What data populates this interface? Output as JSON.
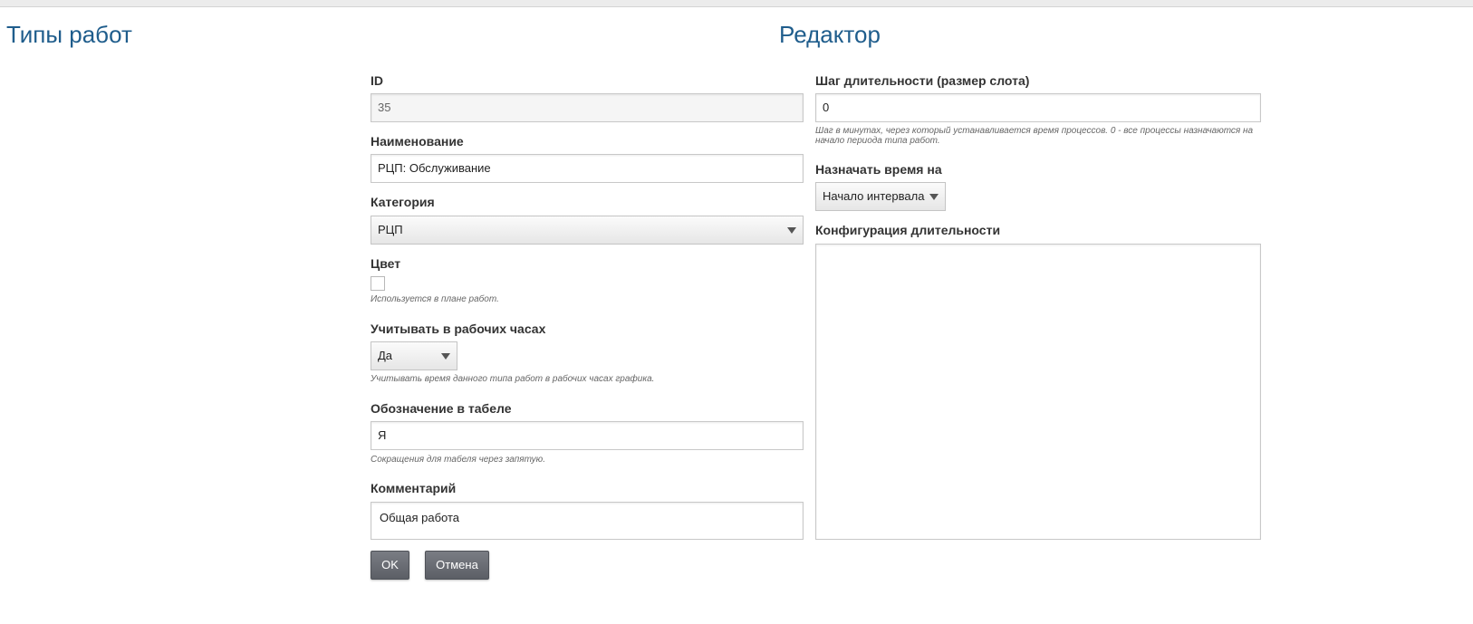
{
  "header": {
    "left_title": "Типы работ",
    "right_title": "Редактор"
  },
  "form": {
    "id": {
      "label": "ID",
      "value": "35"
    },
    "name": {
      "label": "Наименование",
      "value": "РЦП: Обслуживание"
    },
    "category": {
      "label": "Категория",
      "value": "РЦП"
    },
    "color": {
      "label": "Цвет",
      "hint": "Используется в плане работ."
    },
    "working_hours": {
      "label": "Учитывать в рабочих часах",
      "value": "Да",
      "hint": "Учитывать время данного типа работ в рабочих часах графика."
    },
    "timesheet": {
      "label": "Обозначение в табеле",
      "value": "Я",
      "hint": "Сокращения для табеля через запятую."
    },
    "comment": {
      "label": "Комментарий",
      "value": "Общая работа"
    },
    "duration_step": {
      "label": "Шаг длительности (размер слота)",
      "value": "0",
      "hint_line1": "Шаг в минутах, через который устанавливается время процессов. 0 - все процессы назначаются на",
      "hint_line2": "начало периода типа работ."
    },
    "assign_time": {
      "label": "Назначать время на",
      "value": "Начало интервала"
    },
    "duration_config": {
      "label": "Конфигурация длительности",
      "value": ""
    }
  },
  "buttons": {
    "ok": "OK",
    "cancel": "Отмена"
  },
  "icons": {
    "dropdown": "chevron-down-icon"
  }
}
